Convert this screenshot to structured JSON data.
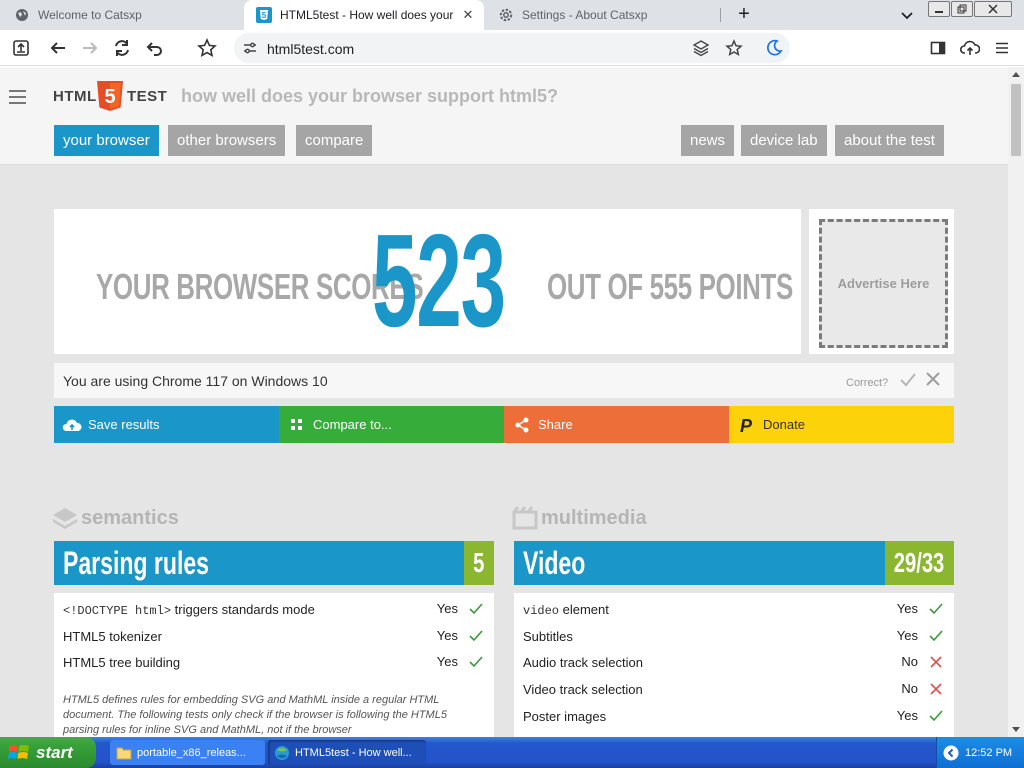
{
  "browser": {
    "tabs": [
      {
        "title": "Welcome to Catsxp",
        "active": false
      },
      {
        "title": "HTML5test - How well does your bro",
        "active": true
      },
      {
        "title": "Settings - About Catsxp",
        "active": false
      }
    ],
    "new_tab_label": "+",
    "url": "html5test.com"
  },
  "site": {
    "logo_left": "HTML",
    "logo_right": "TEST",
    "logo_badge": "5",
    "tagline": "how well does your browser support html5?",
    "nav_left": [
      "your browser",
      "other browsers",
      "compare"
    ],
    "nav_right": [
      "news",
      "device lab",
      "about the test"
    ],
    "score_prefix": "YOUR BROWSER SCORES",
    "score": "523",
    "score_suffix": "OUT OF 555 POINTS",
    "ad_text": "Advertise Here",
    "ua_text": "You are using Chrome 117 on Windows 10",
    "correct_label": "Correct?",
    "actions": [
      {
        "label": "Save results",
        "color": "#1a97c8",
        "icon": "cloud-upload-icon"
      },
      {
        "label": "Compare to...",
        "color": "#36ad3b",
        "icon": "grid-icon"
      },
      {
        "label": "Share",
        "color": "#ee6e39",
        "icon": "share-icon"
      },
      {
        "label": "Donate",
        "color": "#fcd20a",
        "icon": "paypal-icon"
      }
    ],
    "sections": {
      "semantics": {
        "heading": "semantics",
        "category": "Parsing rules",
        "score": "5",
        "rows": [
          {
            "code": "<!DOCTYPE html>",
            "label": " triggers standards mode",
            "result": "Yes",
            "pass": true
          },
          {
            "code": "",
            "label": "HTML5 tokenizer",
            "result": "Yes",
            "pass": true
          },
          {
            "code": "",
            "label": "HTML5 tree building",
            "result": "Yes",
            "pass": true
          }
        ],
        "note": "HTML5 defines rules for embedding SVG and MathML inside a regular HTML document. The following tests only check if the browser is following the HTML5 parsing rules for inline SVG and MathML, not if the browser"
      },
      "multimedia": {
        "heading": "multimedia",
        "category": "Video",
        "score": "29/33",
        "rows": [
          {
            "code": "video",
            "label": " element",
            "result": "Yes",
            "pass": true
          },
          {
            "code": "",
            "label": "Subtitles",
            "result": "Yes",
            "pass": true
          },
          {
            "code": "",
            "label": "Audio track selection",
            "result": "No",
            "pass": false
          },
          {
            "code": "",
            "label": "Video track selection",
            "result": "No",
            "pass": false
          },
          {
            "code": "",
            "label": "Poster images",
            "result": "Yes",
            "pass": true
          }
        ]
      }
    },
    "colors": {
      "accent": "#1a97c8",
      "score_badge": "#8ab630",
      "pass": "#3a9a3a",
      "fail": "#d9534f"
    }
  },
  "taskbar": {
    "start_label": "start",
    "tasks": [
      {
        "title": "portable_x86_releas...",
        "active": false
      },
      {
        "title": "HTML5test - How well...",
        "active": true
      }
    ],
    "clock": "12:52 PM"
  }
}
